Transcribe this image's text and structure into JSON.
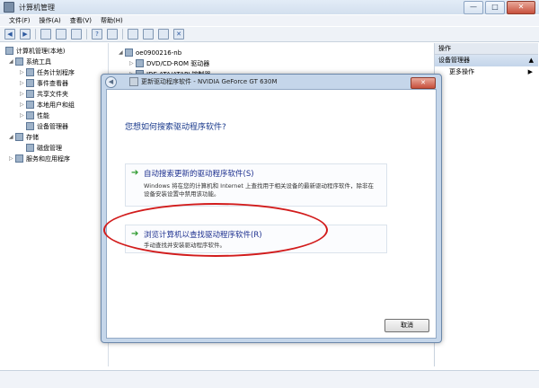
{
  "window": {
    "title": "计算机管理",
    "controls": [
      "—",
      "□",
      "✕"
    ]
  },
  "menu": [
    "文件(F)",
    "操作(A)",
    "查看(V)",
    "帮助(H)"
  ],
  "left_tree": [
    {
      "label": "计算机管理(本地)",
      "level": 0
    },
    {
      "label": "系统工具",
      "level": 1
    },
    {
      "label": "任务计划程序",
      "level": 2
    },
    {
      "label": "事件查看器",
      "level": 2
    },
    {
      "label": "共享文件夹",
      "level": 2
    },
    {
      "label": "本地用户和组",
      "level": 2
    },
    {
      "label": "性能",
      "level": 2
    },
    {
      "label": "设备管理器",
      "level": 2
    },
    {
      "label": "存储",
      "level": 1
    },
    {
      "label": "磁盘管理",
      "level": 2
    },
    {
      "label": "服务和应用程序",
      "level": 1
    }
  ],
  "device_tree": [
    {
      "label": "oe0900216-nb"
    },
    {
      "label": "DVD/CD-ROM 驱动器"
    },
    {
      "label": "IDE ATA/ATAPI 控制器"
    }
  ],
  "right_pane": {
    "header": "操作",
    "section": "设备管理器",
    "link": "更多操作"
  },
  "dialog": {
    "title": "更新驱动程序软件 - NVIDIA GeForce GT 630M",
    "question": "您想如何搜索驱动程序软件?",
    "option1": {
      "title": "自动搜索更新的驱动程序软件(S)",
      "desc": "Windows 将在您的计算机和 Internet 上查找用于相关设备的最新驱动程序软件，除非在设备安装设置中禁用该功能。"
    },
    "option2": {
      "title": "浏览计算机以查找驱动程序软件(R)",
      "desc": "手动查找并安装驱动程序软件。"
    },
    "cancel": "取消"
  }
}
